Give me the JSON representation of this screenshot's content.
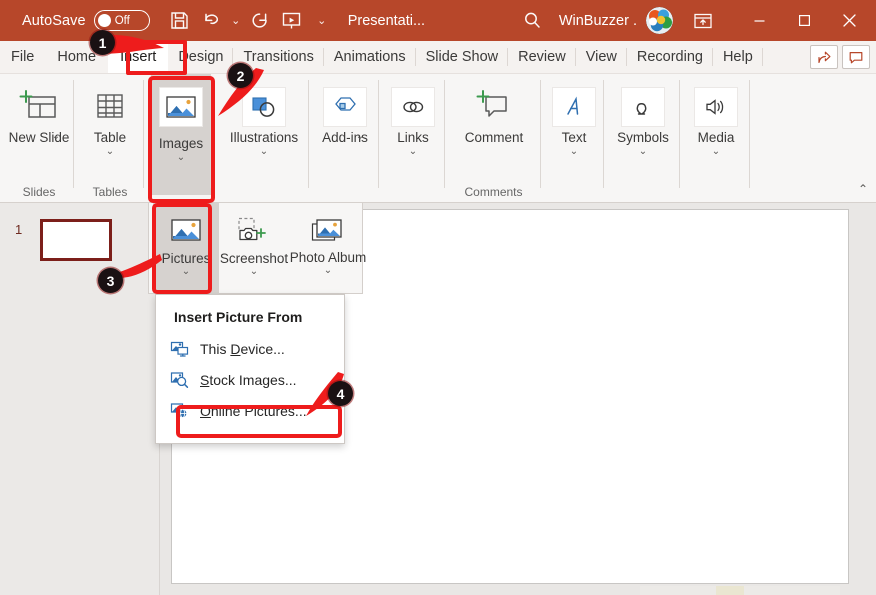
{
  "app": {
    "accent_color": "#b7472a",
    "annotation_color": "#ee1c1c"
  },
  "titlebar": {
    "autosave_label": "AutoSave",
    "autosave_state": "Off",
    "document_title": "Presentati...",
    "user_name": "WinBuzzer .",
    "icons": {
      "save": "save-icon",
      "undo": "undo-icon",
      "undo_chevron": "chevron-down-icon",
      "redo": "redo-icon",
      "present": "start-presentation-icon",
      "customize_chevron": "customize-quick-access-chevron-icon",
      "search": "search-icon",
      "avatar": "user-avatar-icon",
      "ribbon_display": "ribbon-display-options-icon",
      "minimize": "minimize-icon",
      "maximize": "maximize-icon",
      "close": "close-icon"
    }
  },
  "tabs": [
    {
      "label": "File",
      "selected": false
    },
    {
      "label": "Home",
      "selected": false
    },
    {
      "label": "Insert",
      "selected": true
    },
    {
      "label": "Design",
      "selected": false
    },
    {
      "label": "Transitions",
      "selected": false
    },
    {
      "label": "Animations",
      "selected": false
    },
    {
      "label": "Slide Show",
      "selected": false
    },
    {
      "label": "Review",
      "selected": false
    },
    {
      "label": "View",
      "selected": false
    },
    {
      "label": "Recording",
      "selected": false
    },
    {
      "label": "Help",
      "selected": false
    }
  ],
  "tabstrip_buttons": {
    "share": "share-icon",
    "comments": "comments-icon"
  },
  "ribbon": {
    "buttons": [
      {
        "label": "New Slide",
        "chevron": "⌄",
        "icon": "new-slide-icon",
        "pressed": false
      },
      {
        "label": "Table",
        "chevron": "⌄",
        "icon": "table-icon",
        "pressed": false
      },
      {
        "label": "Images",
        "chevron": "⌄",
        "icon": "images-icon",
        "pressed": true
      },
      {
        "label": "Illustrations",
        "chevron": "⌄",
        "icon": "illustrations-icon",
        "pressed": false
      },
      {
        "label": "Add-ins",
        "chevron": "⌄",
        "icon": "add-ins-icon",
        "pressed": false
      },
      {
        "label": "Links",
        "chevron": "⌄",
        "icon": "links-icon",
        "pressed": false
      },
      {
        "label": "Comment",
        "chevron": "",
        "icon": "comment-icon",
        "pressed": false
      },
      {
        "label": "Text",
        "chevron": "⌄",
        "icon": "text-icon",
        "pressed": false
      },
      {
        "label": "Symbols",
        "chevron": "⌄",
        "icon": "symbols-icon",
        "pressed": false
      },
      {
        "label": "Media",
        "chevron": "⌄",
        "icon": "media-icon",
        "pressed": false
      }
    ],
    "group_labels": {
      "slides": "Slides",
      "tables": "Tables",
      "comments": "Comments"
    },
    "collapse_chevron": "⌃"
  },
  "gallery": {
    "items": [
      {
        "label": "Pictures",
        "chevron": "⌄",
        "icon": "pictures-icon",
        "pressed": true
      },
      {
        "label": "Screenshot",
        "chevron": "⌄",
        "icon": "screenshot-icon",
        "pressed": false
      },
      {
        "label": "Photo Album",
        "chevron": "⌄",
        "icon": "photo-album-icon",
        "pressed": false
      }
    ]
  },
  "menu": {
    "header": "Insert Picture From",
    "items": [
      {
        "prefix": "This ",
        "accel": "D",
        "suffix": "evice...",
        "icon": "picture-device-icon",
        "highlighted": false
      },
      {
        "prefix": "",
        "accel": "S",
        "suffix": "tock Images...",
        "icon": "picture-stock-icon",
        "highlighted": false
      },
      {
        "prefix": "",
        "accel": "O",
        "suffix": "nline Pictures...",
        "icon": "picture-online-icon",
        "highlighted": true
      }
    ]
  },
  "thumbnail_pane": {
    "slide_number": "1"
  },
  "callouts": [
    {
      "number": "1",
      "target": "insert-tab"
    },
    {
      "number": "2",
      "target": "images-button"
    },
    {
      "number": "3",
      "target": "pictures-button"
    },
    {
      "number": "4",
      "target": "online-pictures-menu-item"
    }
  ]
}
